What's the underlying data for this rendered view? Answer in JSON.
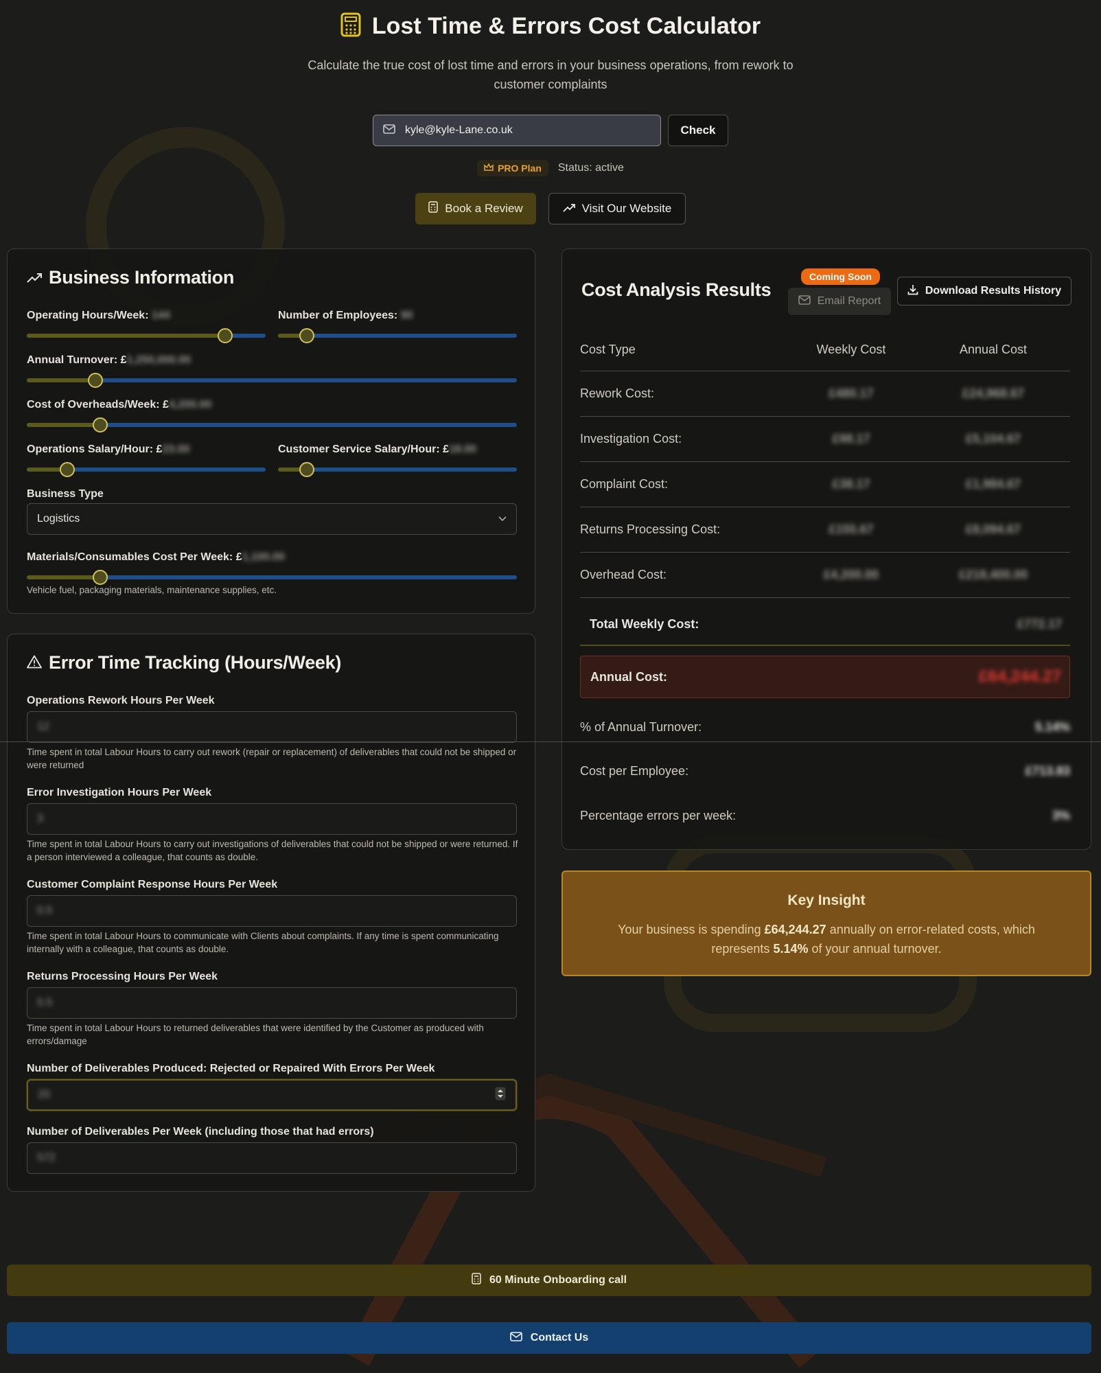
{
  "header": {
    "title": "Lost Time & Errors Cost Calculator",
    "subtitle": "Calculate the true cost of lost time and errors in your business operations, from rework to customer complaints",
    "email_value": "kyle@kyle-Lane.co.uk",
    "check_label": "Check",
    "plan_label": "PRO Plan",
    "status_text": "Status: active",
    "book_review_label": "Book a Review",
    "visit_website_label": "Visit Our Website"
  },
  "business": {
    "title": "Business Information",
    "operating_hours": {
      "label": "Operating Hours/Week: ",
      "value": "144",
      "fraction": 0.83
    },
    "employees": {
      "label": "Number of Employees: ",
      "value": "90",
      "fraction": 0.12
    },
    "turnover": {
      "label": "Annual Turnover: £",
      "value": "1,250,000.00",
      "fraction": 0.14
    },
    "overheads": {
      "label": "Cost of Overheads/Week: £",
      "value": "4,200.00",
      "fraction": 0.15
    },
    "ops_salary": {
      "label": "Operations Salary/Hour: £",
      "value": "23.00",
      "fraction": 0.17
    },
    "cs_salary": {
      "label": "Customer Service Salary/Hour: £",
      "value": "18.00",
      "fraction": 0.12
    },
    "business_type_label": "Business Type",
    "business_type_value": "Logistics",
    "materials": {
      "label": "Materials/Consumables Cost Per Week: £",
      "value": "1,100.00",
      "fraction": 0.15
    },
    "materials_hint": "Vehicle fuel, packaging materials, maintenance supplies, etc."
  },
  "errors": {
    "title": "Error Time Tracking (Hours/Week)",
    "fields": [
      {
        "label": "Operations Rework Hours Per Week",
        "value": "12",
        "hint": "Time spent in total Labour Hours to carry out rework (repair or replacement) of deliverables that could not be shipped or were returned"
      },
      {
        "label": "Error Investigation Hours Per Week",
        "value": "3",
        "hint": "Time spent in total Labour Hours to carry out investigations of deliverables that could not be shipped or were returned. If a person interviewed a colleague, that counts as double."
      },
      {
        "label": "Customer Complaint Response Hours Per Week",
        "value": "0.5",
        "hint": "Time spent in total Labour Hours to communicate with Clients about complaints. If any time is spent communicating internally with a colleague, that counts as double."
      },
      {
        "label": "Returns Processing Hours Per Week",
        "value": "5.5",
        "hint": "Time spent in total Labour Hours to returned deliverables that were identified by the Customer as produced with errors/damage"
      },
      {
        "label": "Number of Deliverables Produced: Rejected or Repaired With Errors Per Week",
        "value": "20",
        "hint": ""
      },
      {
        "label": "Number of Deliverables Per Week (including those that had errors)",
        "value": "572",
        "hint": ""
      }
    ]
  },
  "results": {
    "title": "Cost Analysis Results",
    "coming_soon": "Coming Soon",
    "email_report": "Email Report",
    "download_label": "Download Results History",
    "headers": [
      "Cost Type",
      "Weekly Cost",
      "Annual Cost"
    ],
    "rows": [
      {
        "type": "Rework Cost:",
        "weekly": "£480.17",
        "annual": "£24,968.67"
      },
      {
        "type": "Investigation Cost:",
        "weekly": "£98.17",
        "annual": "£5,104.67"
      },
      {
        "type": "Complaint Cost:",
        "weekly": "£38.17",
        "annual": "£1,984.67"
      },
      {
        "type": "Returns Processing Cost:",
        "weekly": "£155.67",
        "annual": "£8,094.67"
      },
      {
        "type": "Overhead Cost:",
        "weekly": "£4,200.00",
        "annual": "£218,400.00"
      }
    ],
    "total_weekly_label": "Total Weekly Cost:",
    "total_weekly_value": "£772.17",
    "annual_label": "Annual Cost:",
    "annual_value": "£64,244.27",
    "pct_turnover_label": "% of Annual Turnover:",
    "pct_turnover_value": "5.14%",
    "per_employee_label": "Cost per Employee:",
    "per_employee_value": "£713.83",
    "pct_errors_label": "Percentage errors per week:",
    "pct_errors_value": "3%"
  },
  "insight": {
    "title": "Key Insight",
    "text_a": "Your business is spending ",
    "amount": "£64,244.27",
    "text_b": " annually on error-related costs, which represents ",
    "percent": "5.14%",
    "text_c": " of your annual turnover."
  },
  "footer": {
    "onboarding_label": "60 Minute Onboarding call",
    "contact_label": "Contact Us"
  },
  "colors": {
    "accent": "#cfc25a",
    "track": "#1f4e8a",
    "brand_orange": "#ec6a12",
    "danger": "#e03a33"
  }
}
